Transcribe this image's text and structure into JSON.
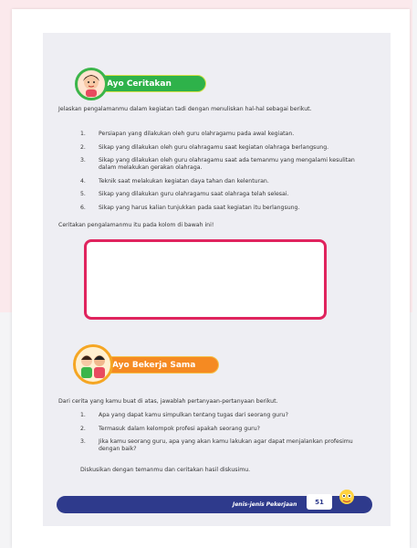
{
  "section1": {
    "title": "Ayo Ceritakan",
    "intro": "Jelaskan pengalamanmu dalam kegiatan tadi dengan menuliskan hal-hal sebagai berikut.",
    "items": [
      {
        "num": "1.",
        "text": "Persiapan yang dilakukan oleh guru olahragamu pada awal kegiatan."
      },
      {
        "num": "2.",
        "text": "Sikap yang dilakukan oleh guru olahragamu saat kegiatan olahraga berlangsung."
      },
      {
        "num": "3.",
        "text": "Sikap yang dilakukan oleh guru olahragamu saat ada temanmu yang mengalami kesulitan dalam melakukan gerakan olahraga."
      },
      {
        "num": "4.",
        "text": "Teknik saat melakukan kegiatan daya tahan dan kelenturan."
      },
      {
        "num": "5.",
        "text": "Sikap yang dilakukan guru olahragamu saat olahraga telah selesai."
      },
      {
        "num": "6.",
        "text": "Sikap yang harus kalian tunjukkan pada saat kegiatan itu berlangsung."
      }
    ],
    "instruction": "Ceritakan pengalamanmu itu pada kolom di bawah ini!"
  },
  "section2": {
    "title": "Ayo Bekerja Sama",
    "intro": "Dari cerita yang kamu buat di atas, jawablah pertanyaan-pertanyaan berikut.",
    "items": [
      {
        "num": "1.",
        "text": "Apa yang dapat kamu simpulkan tentang tugas dari seorang guru?"
      },
      {
        "num": "2.",
        "text": "Termasuk dalam kelompok profesi apakah seorang guru?"
      },
      {
        "num": "3.",
        "text": "Jika kamu seorang guru, apa yang akan kamu lakukan agar dapat menjalankan profesimu dengan baik?"
      }
    ],
    "closing": "Diskusikan dengan temanmu dan ceritakan hasil diskusimu."
  },
  "footer": {
    "chapter": "Jenis-jenis Pekerjaan",
    "page_number": "51"
  },
  "colors": {
    "green": "#2eb24a",
    "orange": "#f58a22",
    "navy": "#2e3a8c",
    "box_border": "#e0245e"
  }
}
